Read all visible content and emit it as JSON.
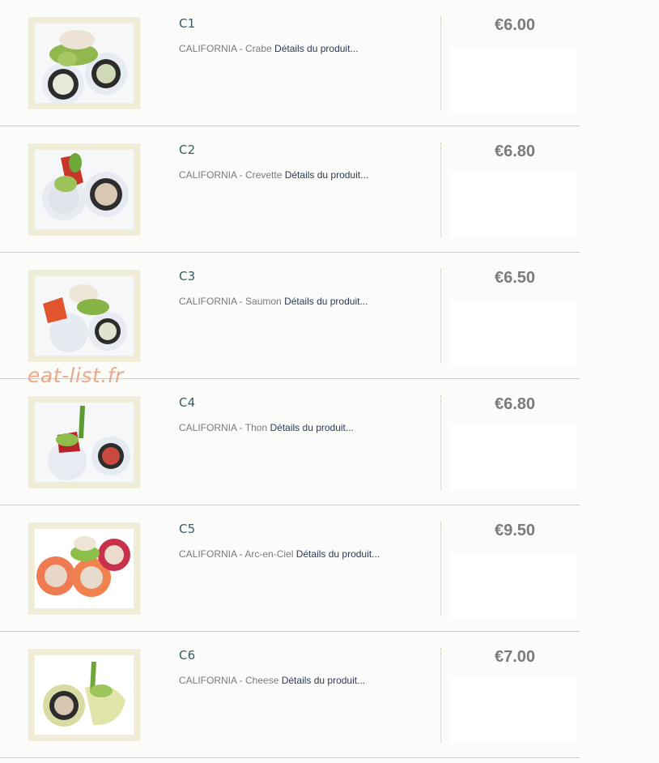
{
  "products": [
    {
      "code": "C1",
      "name": "CALIFORNIA - Crabe",
      "link": "Détails du produit...",
      "price": "€6.00",
      "image_icon": "california-crabe-sushi-image"
    },
    {
      "code": "C2",
      "name": "CALIFORNIA - Crevette",
      "link": "Détails du produit...",
      "price": "€6.80",
      "image_icon": "california-crevette-sushi-image"
    },
    {
      "code": "C3",
      "name": "CALIFORNIA - Saumon",
      "link": "Détails du produit...",
      "price": "€6.50",
      "image_icon": "california-saumon-sushi-image"
    },
    {
      "code": "C4",
      "name": "CALIFORNIA - Thon",
      "link": "Détails du produit...",
      "price": "€6.80",
      "image_icon": "california-thon-sushi-image"
    },
    {
      "code": "C5",
      "name": "CALIFORNIA - Arc-en-Ciel",
      "link": "Détails du produit...",
      "price": "€9.50",
      "image_icon": "california-arc-en-ciel-sushi-image"
    },
    {
      "code": "C6",
      "name": "CALIFORNIA - Cheese",
      "link": "Détails du produit...",
      "price": "€7.00",
      "image_icon": "california-cheese-sushi-image"
    }
  ],
  "watermark": "eat-list.fr",
  "colors": {
    "code_text": "#3a5a66",
    "link_text": "#2b3a55",
    "price_text": "#7b7b7b",
    "row_border": "#e4c9a0",
    "thumb_frame": "#efecd7",
    "watermark": "#ea9a74"
  }
}
